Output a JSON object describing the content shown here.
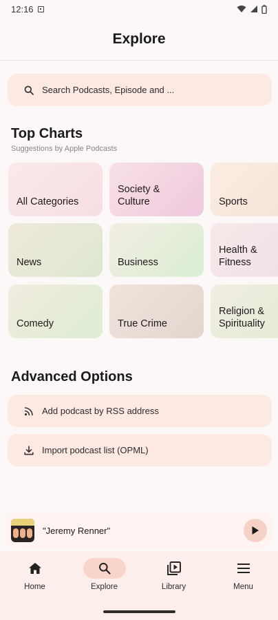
{
  "status": {
    "time": "12:16"
  },
  "header": {
    "title": "Explore"
  },
  "search": {
    "placeholder": "Search Podcasts, Episode and ..."
  },
  "top_charts": {
    "title": "Top Charts",
    "subtitle": "Suggestions by Apple Podcasts",
    "categories": [
      {
        "line1": "All Categories",
        "line2": ""
      },
      {
        "line1": "Society &",
        "line2": "Culture"
      },
      {
        "line1": "Sports",
        "line2": ""
      },
      {
        "line1": "News",
        "line2": ""
      },
      {
        "line1": "Business",
        "line2": ""
      },
      {
        "line1": "Health &",
        "line2": "Fitness"
      },
      {
        "line1": "Comedy",
        "line2": ""
      },
      {
        "line1": "True Crime",
        "line2": ""
      },
      {
        "line1": "Religion &",
        "line2": "Spirituality"
      }
    ]
  },
  "advanced": {
    "title": "Advanced Options",
    "rss_label": "Add podcast by RSS address",
    "opml_label": "Import podcast list (OPML)"
  },
  "player": {
    "title": "\"Jeremy Renner\""
  },
  "nav": {
    "home": "Home",
    "explore": "Explore",
    "library": "Library",
    "menu": "Menu"
  },
  "colors": {
    "accent": "#f9d5c9",
    "surface": "#fde9e2",
    "background": "#fdf8f8"
  }
}
